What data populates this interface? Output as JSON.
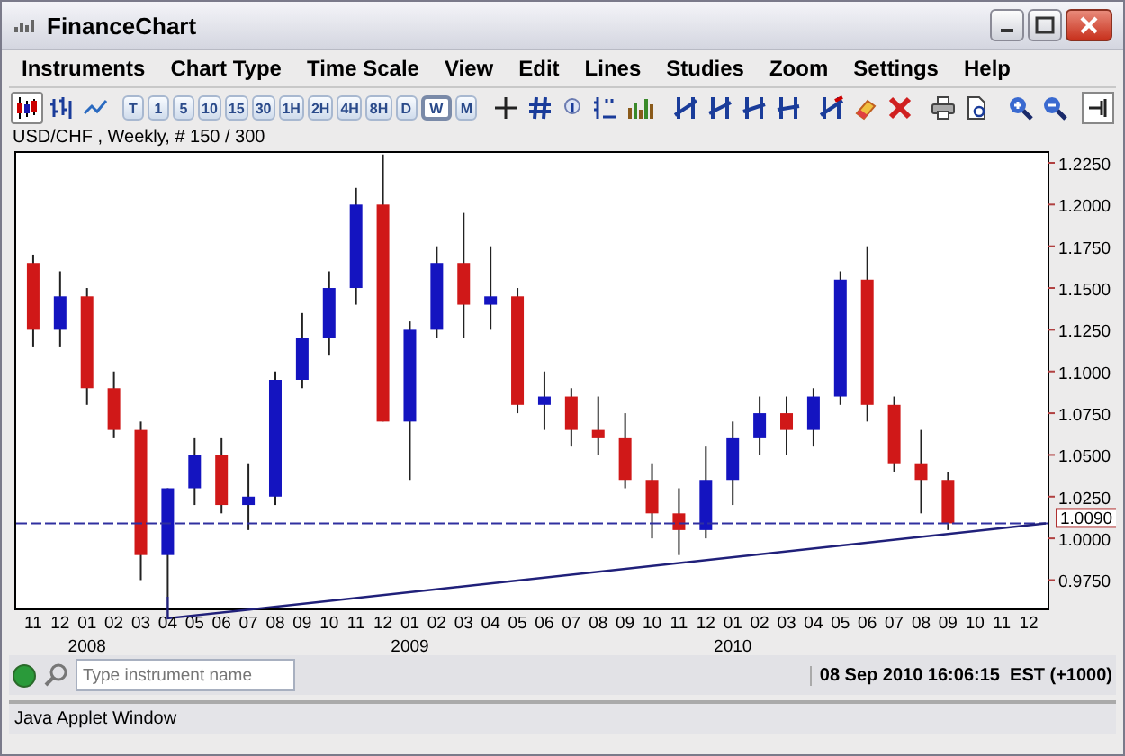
{
  "window": {
    "title": "FinanceChart"
  },
  "menu": [
    "Instruments",
    "Chart Type",
    "Time Scale",
    "View",
    "Edit",
    "Lines",
    "Studies",
    "Zoom",
    "Settings",
    "Help"
  ],
  "chart_type_buttons": [
    {
      "selected": true
    },
    {
      "selected": false
    },
    {
      "selected": false
    }
  ],
  "timeframes": [
    {
      "label": "T",
      "selected": false
    },
    {
      "label": "1",
      "selected": false
    },
    {
      "label": "5",
      "selected": false
    },
    {
      "label": "10",
      "selected": false
    },
    {
      "label": "15",
      "selected": false
    },
    {
      "label": "30",
      "selected": false
    },
    {
      "label": "1H",
      "selected": false
    },
    {
      "label": "2H",
      "selected": false
    },
    {
      "label": "4H",
      "selected": false
    },
    {
      "label": "8H",
      "selected": false
    },
    {
      "label": "D",
      "selected": false
    },
    {
      "label": "W",
      "selected": true
    },
    {
      "label": "M",
      "selected": false
    }
  ],
  "chart_info": "USD/CHF , Weekly, # 150 / 300",
  "chart_data": {
    "type": "candlestick",
    "ylim": [
      0.958,
      1.232
    ],
    "yticks": [
      {
        "value": 0.975,
        "label": "0.9750"
      },
      {
        "value": 1.0,
        "label": "1.0000"
      },
      {
        "value": 1.025,
        "label": "1.0250"
      },
      {
        "value": 1.05,
        "label": "1.0500"
      },
      {
        "value": 1.075,
        "label": "1.0750"
      },
      {
        "value": 1.1,
        "label": "1.1000"
      },
      {
        "value": 1.125,
        "label": "1.1250"
      },
      {
        "value": 1.15,
        "label": "1.1500"
      },
      {
        "value": 1.175,
        "label": "1.1750"
      },
      {
        "value": 1.2,
        "label": "1.2000"
      },
      {
        "value": 1.225,
        "label": "1.2250"
      }
    ],
    "categories": [
      "11",
      "12",
      "01",
      "02",
      "03",
      "04",
      "05",
      "06",
      "07",
      "08",
      "09",
      "10",
      "11",
      "12",
      "01",
      "02",
      "03",
      "04",
      "05",
      "06",
      "07",
      "08",
      "09",
      "10",
      "11",
      "12",
      "01",
      "02",
      "03",
      "04",
      "05",
      "06",
      "07",
      "08",
      "09",
      "10",
      "11",
      "12"
    ],
    "ohlc": [
      [
        1.165,
        1.17,
        1.115,
        1.125
      ],
      [
        1.125,
        1.16,
        1.115,
        1.145
      ],
      [
        1.145,
        1.15,
        1.08,
        1.09
      ],
      [
        1.09,
        1.1,
        1.06,
        1.065
      ],
      [
        1.065,
        1.07,
        0.975,
        0.99
      ],
      [
        0.99,
        1.03,
        0.965,
        1.03
      ],
      [
        1.03,
        1.06,
        1.02,
        1.05
      ],
      [
        1.05,
        1.06,
        1.015,
        1.02
      ],
      [
        1.02,
        1.045,
        1.005,
        1.025
      ],
      [
        1.025,
        1.1,
        1.02,
        1.095
      ],
      [
        1.095,
        1.135,
        1.09,
        1.12
      ],
      [
        1.12,
        1.16,
        1.11,
        1.15
      ],
      [
        1.15,
        1.21,
        1.14,
        1.2
      ],
      [
        1.2,
        1.23,
        1.07,
        1.07
      ],
      [
        1.07,
        1.13,
        1.035,
        1.125
      ],
      [
        1.125,
        1.175,
        1.12,
        1.165
      ],
      [
        1.165,
        1.195,
        1.12,
        1.14
      ],
      [
        1.14,
        1.175,
        1.125,
        1.145
      ],
      [
        1.145,
        1.15,
        1.075,
        1.08
      ],
      [
        1.08,
        1.1,
        1.065,
        1.085
      ],
      [
        1.085,
        1.09,
        1.055,
        1.065
      ],
      [
        1.065,
        1.085,
        1.05,
        1.06
      ],
      [
        1.06,
        1.075,
        1.03,
        1.035
      ],
      [
        1.035,
        1.045,
        1.0,
        1.015
      ],
      [
        1.015,
        1.03,
        0.99,
        1.005
      ],
      [
        1.005,
        1.055,
        1.0,
        1.035
      ],
      [
        1.035,
        1.07,
        1.02,
        1.06
      ],
      [
        1.06,
        1.085,
        1.05,
        1.075
      ],
      [
        1.075,
        1.085,
        1.05,
        1.065
      ],
      [
        1.065,
        1.09,
        1.055,
        1.085
      ],
      [
        1.085,
        1.16,
        1.08,
        1.155
      ],
      [
        1.155,
        1.175,
        1.07,
        1.08
      ],
      [
        1.08,
        1.085,
        1.04,
        1.045
      ],
      [
        1.045,
        1.065,
        1.015,
        1.035
      ],
      [
        1.035,
        1.04,
        1.005,
        1.009
      ],
      null,
      null,
      null
    ],
    "ref_lines": [
      {
        "axis": "y",
        "value": 1.009,
        "label": "1.0090"
      }
    ]
  },
  "year_labels": [
    "2008",
    "2009",
    "2010"
  ],
  "search": {
    "placeholder": "Type instrument name"
  },
  "connection": {
    "on": true
  },
  "clock": "08 Sep 2010 16:06:15  EST (+1000)",
  "status_bar": "Java Applet Window"
}
